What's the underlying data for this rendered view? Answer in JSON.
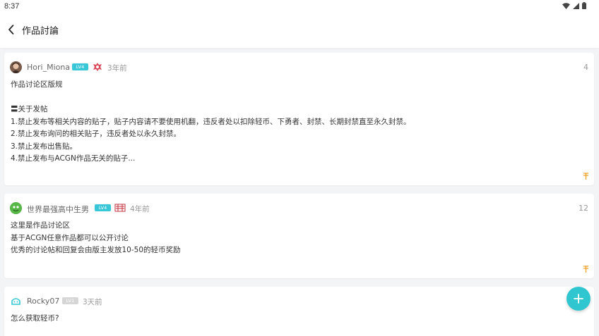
{
  "status_bar": {
    "time": "8:37"
  },
  "header": {
    "title": "作品討論"
  },
  "posts": [
    {
      "username": "Hori_Miona",
      "level_badge": "LV4",
      "time": "3年前",
      "reply_count": "4",
      "body": "作品讨论区版规\n\n〓关于发帖\n1.禁止发布等相关内容的贴子，贴子内容请不要使用机翻，违反者处以扣除轻币、下勇者、封禁、长期封禁直至永久封禁。\n2.禁止发布询问的相关贴子，违反者处以永久封禁。\n3.禁止发布出售贴。\n4.禁止发布与ACGN作品无关的贴子..."
    },
    {
      "username": "世界最强高中生男",
      "level_badge": "LV4",
      "time": "4年前",
      "reply_count": "12",
      "body": "这里是作品讨论区\n基于ACGN任意作品都可以公开讨论\n优秀的讨论帖和回复会由版主发放10-50的轻币奖励"
    },
    {
      "username": "Rocky07",
      "level_badge": "LV1",
      "time": "3天前",
      "reply_count": "",
      "body": "怎么获取轻币?"
    }
  ],
  "colors": {
    "accent": "#2fc6cf",
    "background": "#f3f4f6",
    "badge_active": "#39c7d8",
    "badge_inactive": "#d6d6d6",
    "coin": "#f0a020"
  },
  "icons": {
    "back": "chevron-left-icon",
    "fab": "plus-icon",
    "coin": "coin-icon",
    "wifi": "wifi-icon",
    "signal": "signal-icon",
    "battery": "battery-icon"
  }
}
